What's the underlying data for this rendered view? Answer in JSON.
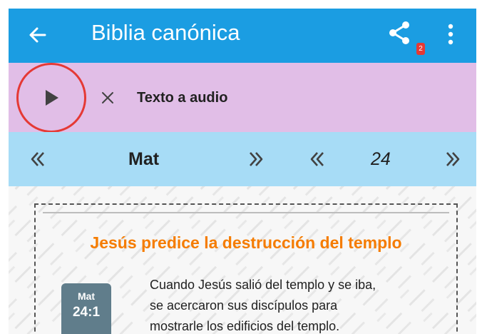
{
  "app_bar": {
    "title": "Biblia canónica",
    "back_icon": "arrow-left-icon",
    "share_icon": "share-icon",
    "share_badge": "2",
    "more_icon": "more-vertical-icon"
  },
  "tts_bar": {
    "play_icon": "play-icon",
    "close_icon": "close-icon",
    "label": "Texto a audio"
  },
  "nav_bar": {
    "book": "Mat",
    "chapter": "24",
    "prev_book_icon": "double-chevron-left-icon",
    "next_book_icon": "double-chevron-right-icon",
    "prev_chapter_icon": "double-chevron-left-icon",
    "next_chapter_icon": "double-chevron-right-icon"
  },
  "content": {
    "heading": "Jesús predice la destrucción del templo",
    "verse_badge": {
      "book": "Mat",
      "ref": "24:1"
    },
    "verse_lines": [
      "Cuando Jesús salió del templo y se iba,",
      "se acercaron sus discípulos para",
      "mostrarle los edificios del templo."
    ]
  },
  "colors": {
    "app_bar": "#1b9de2",
    "tts_bar": "#e1bee7",
    "nav_bar": "#a7dcf6",
    "heading": "#f57c00",
    "highlight_ring": "#e53935",
    "verse_badge": "#607d8b"
  }
}
